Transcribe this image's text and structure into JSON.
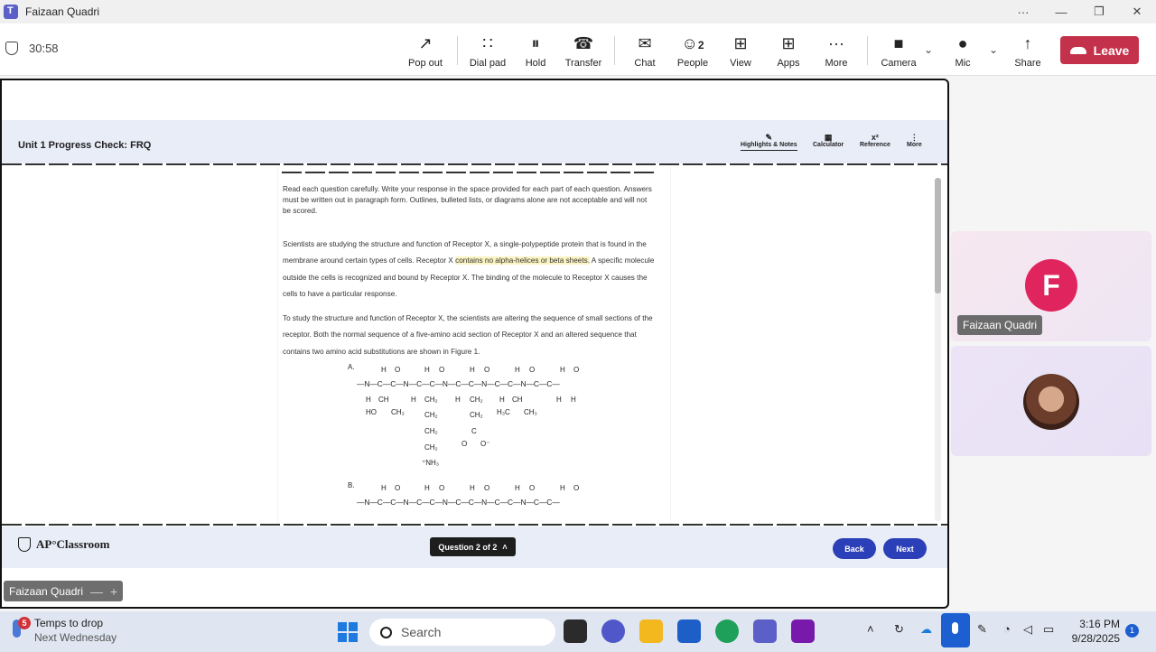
{
  "titlebar": {
    "title": "Faizaan Quadri",
    "more": "···",
    "minimize": "—",
    "maximize": "❐",
    "close": "✕"
  },
  "callbar": {
    "timer": "30:58",
    "buttons": {
      "popout": {
        "label": "Pop out",
        "icon": "↗"
      },
      "dialpad": {
        "label": "Dial pad",
        "icon": "∷"
      },
      "hold": {
        "label": "Hold",
        "icon": "⏸"
      },
      "transfer": {
        "label": "Transfer",
        "icon": "☎"
      },
      "chat": {
        "label": "Chat",
        "icon": "✉"
      },
      "people": {
        "label": "People",
        "icon": "☺",
        "count": "2"
      },
      "view": {
        "label": "View",
        "icon": "⊞"
      },
      "apps": {
        "label": "Apps",
        "icon": "⊞"
      },
      "more": {
        "label": "More",
        "icon": "···"
      },
      "camera": {
        "label": "Camera",
        "icon": "■"
      },
      "mic": {
        "label": "Mic",
        "icon": "●"
      },
      "share": {
        "label": "Share",
        "icon": "↑"
      }
    },
    "chevron": "⌄",
    "leave": "Leave"
  },
  "ap": {
    "title": "Unit 1 Progress Check: FRQ",
    "tools": {
      "highlights": "Highlights & Notes",
      "calculator": "Calculator",
      "reference": "Reference",
      "more": "More"
    },
    "tool_icons": {
      "highlights": "✎",
      "calculator": "▦",
      "reference": "x²",
      "more": "⋮"
    },
    "instructions": "Read each question carefully. Write your response in the space provided for each part of each question. Answers must be written out in paragraph form. Outlines, bulleted lists, or diagrams alone are not acceptable and will not be scored.",
    "para1_a": "Scientists are studying the structure and function of Receptor X, a single-polypeptide protein that is found in the membrane around certain types of cells. Receptor X ",
    "para1_hl": "contains no alpha-helices or beta sheets.",
    "para1_b": " A specific molecule outside the cells is recognized and bound by Receptor X. The binding of the molecule to Receptor X causes the cells to have a particular response.",
    "para2": "To study the structure and function of Receptor X, the scientists are altering the sequence of small sections of the receptor. Both the normal sequence of a five-amino acid section of Receptor X and an altered sequence that contains two amino acid substitutions are shown in Figure 1.",
    "figure": {
      "label_a": "A.",
      "label_b": "B.",
      "backbone": "—N—C—C—N—C—C—N—C—C—N—C—C—N—C—C—",
      "top_atoms": [
        "H",
        "O",
        "H",
        "O",
        "H",
        "O",
        "H",
        "O",
        "H",
        "O"
      ],
      "side1": [
        "H",
        "CH",
        "HO",
        "CH₃"
      ],
      "side2": [
        "H",
        "CH₂",
        "CH₂",
        "CH₂",
        "CH₂",
        "⁺NH₃"
      ],
      "side3": [
        "H",
        "CH₂",
        "CH₂",
        "C",
        "O",
        "O⁻"
      ],
      "side4": [
        "H",
        "CH",
        "H₃C",
        "CH₃"
      ],
      "side5": [
        "H",
        "H"
      ]
    },
    "question_nav": "Question 2 of 2",
    "question_nav_icon": "˄",
    "back": "Back",
    "next": "Next",
    "logo": "AP°Classroom"
  },
  "presenter_chip": {
    "name": "Faizaan Quadri",
    "minus": "—",
    "plus": "+"
  },
  "participants": [
    {
      "initial": "F",
      "name": "Faizaan Quadri",
      "avatar_color": "#e0245e"
    },
    {
      "type": "photo"
    }
  ],
  "taskbar": {
    "weather_title": "Temps to drop",
    "weather_sub": "Next Wednesday",
    "weather_badge": "5",
    "search_placeholder": "Search",
    "time": "3:16 PM",
    "date": "9/28/2025",
    "notifications": "1",
    "tray_chevron": "˄"
  },
  "colors": {
    "leave": "#c4314b",
    "ap_blue": "#2b3fb8",
    "ap_bg": "#e9edf8",
    "accent": "#5b5fc7"
  }
}
